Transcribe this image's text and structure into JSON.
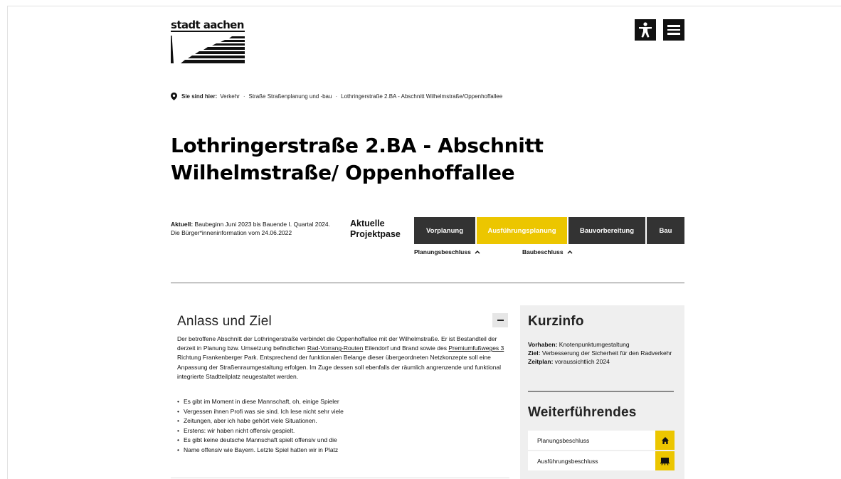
{
  "logo": {
    "text": "stadt aachen"
  },
  "header": {
    "accessibility_icon": "accessibility-icon",
    "menu_icon": "menu-icon"
  },
  "breadcrumb": {
    "label": "Sie sind hier:",
    "items": [
      "Verkehr",
      "Straße Straßenplanung und -bau",
      "Lothringerstraße 2.BA - Abschnitt Wilhelmstraße/Oppenhoffallee"
    ],
    "separator": "·"
  },
  "title": "Lothringerstraße 2.BA - Abschnitt Wilhelmstraße/ Oppenhoffallee",
  "status": {
    "label": "Aktuell:",
    "text": "Baubeginn Juni 2023 bis Bauende I. Quartal 2024. Die Bürger*inneninformation vom 24.06.2022",
    "phase_label": "Aktuelle Projektpase",
    "phases": [
      "Vorplanung",
      "Ausführungsplanung",
      "Bauvorbereitung",
      "Bau"
    ],
    "active_phase": "Ausführungsplanung",
    "milestones": [
      "Planungsbeschluss",
      "Baubeschluss"
    ],
    "accent_color": "#ecc600"
  },
  "main": {
    "title": "Anlass und Ziel",
    "p1": "Der betroffene Abschnitt der Lothringerstraße verbindet die Oppenhoffallee mit der Wilhelmstraße. Er ist Bestandteil der derzeit in Planung bzw. Umsetzung befindlichen ",
    "link1": "Rad-Vorrang-Routen",
    "p2": " Eilendorf und Brand sowie des ",
    "link2": "Premiumfußweges 3",
    "p3": " Richtung Frankenberger Park. Entsprechend der funktionalen Belange dieser übergeordneten Netzkonzepte soll eine Anpassung der Straßenraumgestaltung erfolgen. Im Zuge dessen soll ebenfalls der räumlich angrenzende und funktional integrierte Stadtteilplatz neugestaltet werden.",
    "bullets": [
      "Es gibt im Moment in diese Mannschaft, oh, einige Spieler",
      "Vergessen ihnen Profi was sie sind. Ich lese nicht sehr viele",
      "Zeitungen, aber ich habe gehört viele Situationen.",
      "Erstens: wir haben nicht offensiv gespielt.",
      "Es gibt keine deutsche Mannschaft spielt offensiv und die",
      "Name offensiv wie Bayern. Letzte Spiel hatten wir in Platz"
    ]
  },
  "sidebar": {
    "kurzinfo_title": "Kurzinfo",
    "vorhaben_label": "Vorhaben:",
    "vorhaben": "Knotenpunktumgestaltung",
    "ziel_label": "Ziel:",
    "ziel": "Verbesserung der Sicherheit für den Radverkehr",
    "zeitplan_label": "Zeitplan:",
    "zeitplan": "voraussichtlich 2024",
    "weiter_title": "Weiterführendes",
    "links": [
      {
        "label": "Planungsbeschluss",
        "icon": "home-icon"
      },
      {
        "label": "Ausführungsbeschluss",
        "icon": "easel-icon"
      }
    ]
  }
}
